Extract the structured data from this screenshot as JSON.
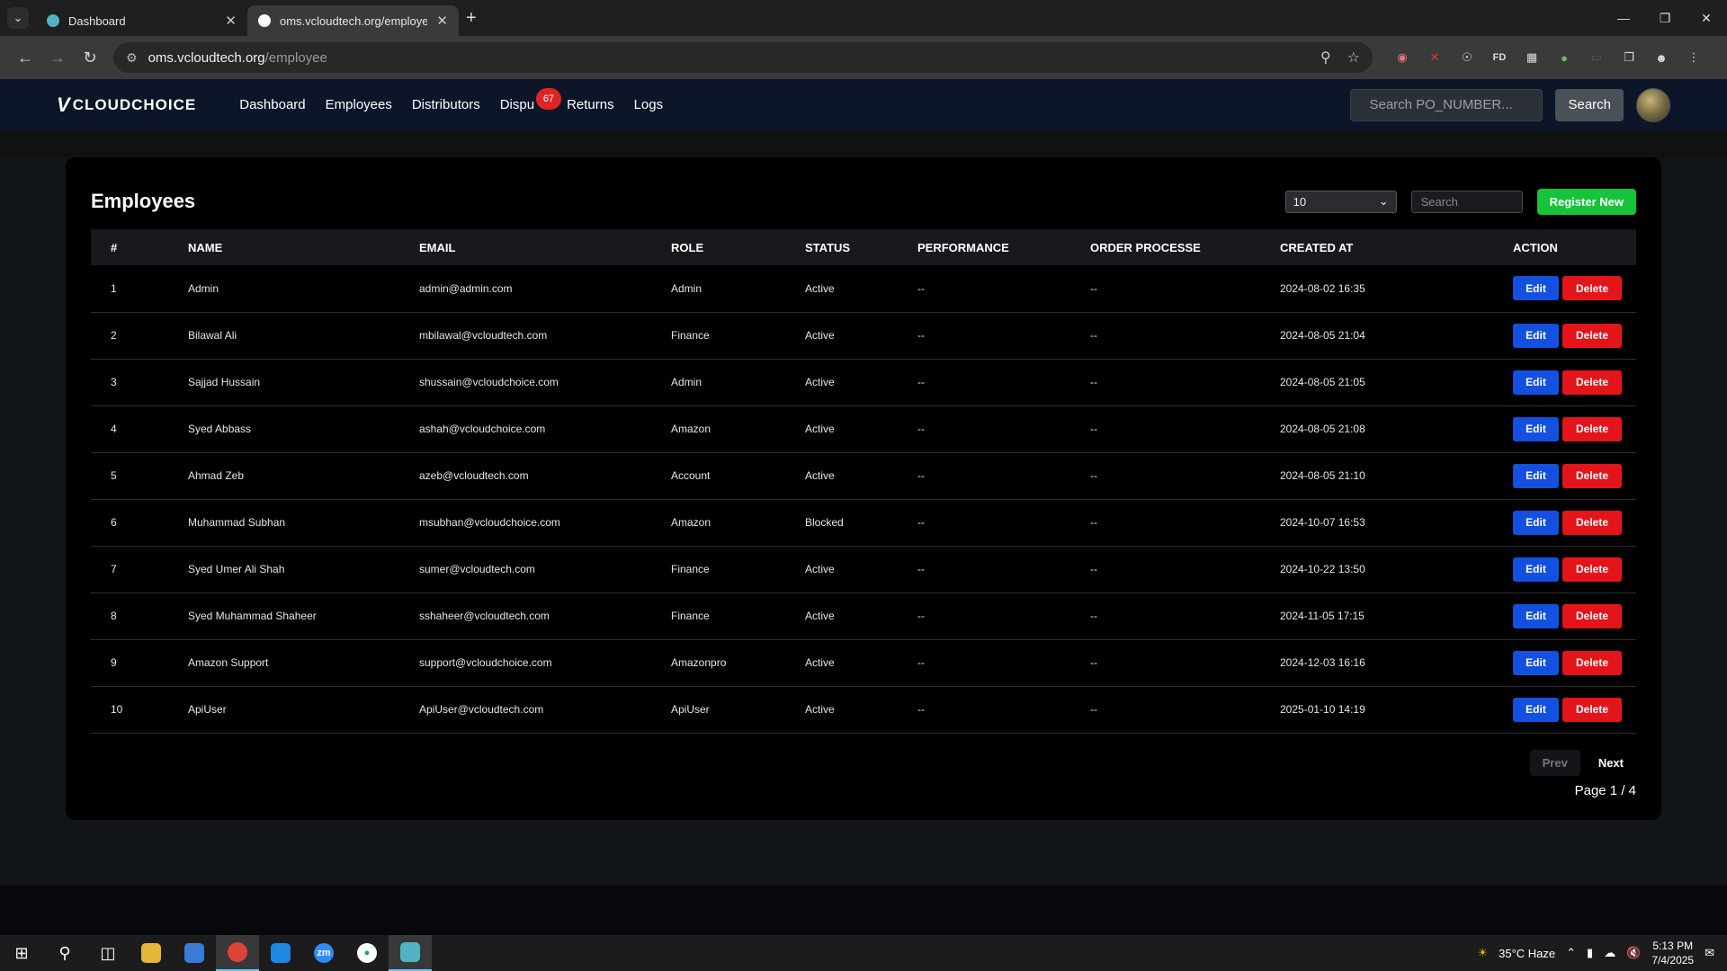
{
  "browser": {
    "tabs": [
      {
        "title": "Dashboard",
        "active": false
      },
      {
        "title": "oms.vcloudtech.org/employee",
        "active": true
      }
    ],
    "url_host": "oms.vcloudtech.org",
    "url_path": "/employee"
  },
  "nav": {
    "brand": "CLOUDCHOICE",
    "links": [
      "Dashboard",
      "Employees",
      "Distributors",
      "Dispu",
      "Returns",
      "Logs"
    ],
    "disputes_badge": "67",
    "search_placeholder": "Search PO_NUMBER...",
    "search_button": "Search"
  },
  "page": {
    "title": "Employees",
    "per_page": "10",
    "search_placeholder": "Search",
    "register_button": "Register New",
    "columns": [
      "#",
      "NAME",
      "EMAIL",
      "ROLE",
      "STATUS",
      "PERFORMANCE",
      "ORDER PROCESSE",
      "CREATED AT",
      "ACTION"
    ],
    "edit_label": "Edit",
    "delete_label": "Delete",
    "rows": [
      {
        "id": "1",
        "name": "Admin",
        "email": "admin@admin.com",
        "role": "Admin",
        "status": "Active",
        "performance": "--",
        "orders": "--",
        "created": "2024-08-02 16:35"
      },
      {
        "id": "2",
        "name": "Bilawal Ali",
        "email": "mbilawal@vcloudtech.com",
        "role": "Finance",
        "status": "Active",
        "performance": "--",
        "orders": "--",
        "created": "2024-08-05 21:04"
      },
      {
        "id": "3",
        "name": "Sajjad Hussain",
        "email": "shussain@vcloudchoice.com",
        "role": "Admin",
        "status": "Active",
        "performance": "--",
        "orders": "--",
        "created": "2024-08-05 21:05"
      },
      {
        "id": "4",
        "name": "Syed Abbass",
        "email": "ashah@vcloudchoice.com",
        "role": "Amazon",
        "status": "Active",
        "performance": "--",
        "orders": "--",
        "created": "2024-08-05 21:08"
      },
      {
        "id": "5",
        "name": "Ahmad Zeb",
        "email": "azeb@vcloudtech.com",
        "role": "Account",
        "status": "Active",
        "performance": "--",
        "orders": "--",
        "created": "2024-08-05 21:10"
      },
      {
        "id": "6",
        "name": "Muhammad Subhan",
        "email": "msubhan@vcloudchoice.com",
        "role": "Amazon",
        "status": "Blocked",
        "performance": "--",
        "orders": "--",
        "created": "2024-10-07 16:53"
      },
      {
        "id": "7",
        "name": "Syed Umer Ali Shah",
        "email": "sumer@vcloudtech.com",
        "role": "Finance",
        "status": "Active",
        "performance": "--",
        "orders": "--",
        "created": "2024-10-22 13:50"
      },
      {
        "id": "8",
        "name": "Syed Muhammad Shaheer",
        "email": "sshaheer@vcloudtech.com",
        "role": "Finance",
        "status": "Active",
        "performance": "--",
        "orders": "--",
        "created": "2024-11-05 17:15"
      },
      {
        "id": "9",
        "name": "Amazon Support",
        "email": "support@vcloudchoice.com",
        "role": "Amazonpro",
        "status": "Active",
        "performance": "--",
        "orders": "--",
        "created": "2024-12-03 16:16"
      },
      {
        "id": "10",
        "name": "ApiUser",
        "email": "ApiUser@vcloudtech.com",
        "role": "ApiUser",
        "status": "Active",
        "performance": "--",
        "orders": "--",
        "created": "2025-01-10 14:19"
      }
    ],
    "prev_label": "Prev",
    "next_label": "Next",
    "page_info": "Page 1 / 4"
  },
  "taskbar": {
    "weather": "35°C  Haze",
    "time": "5:13 PM",
    "date": "7/4/2025",
    "zoom_label": "zm"
  },
  "colors": {
    "nav_bg": "#0d1628",
    "register": "#16c33a",
    "edit": "#1450e0",
    "delete": "#e3151b",
    "badge": "#e02424"
  }
}
